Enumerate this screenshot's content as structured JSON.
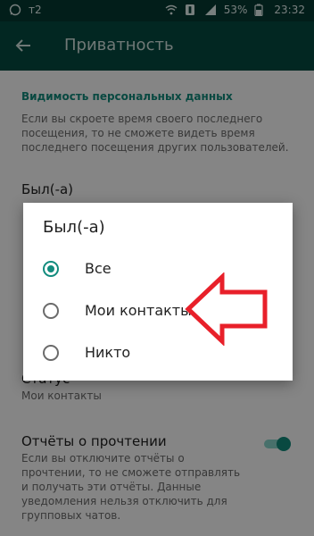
{
  "status_bar": {
    "carrier": "т2",
    "battery_percent": "53%",
    "time": "23:32",
    "icons": [
      "whatsapp-icon",
      "wifi-icon",
      "sim1-icon",
      "signal-icon",
      "battery-icon"
    ]
  },
  "appbar": {
    "title": "Приватность",
    "back_icon": "arrow-left-icon"
  },
  "settings": {
    "section_title": "Видимость персональных данных",
    "section_desc": "Если вы скроете время своего последнего посещения, то не сможете видеть время последнего посещения других пользователей.",
    "last_seen_title": "Был(-а)",
    "status_title": "Статус",
    "status_value": "Мои контакты",
    "read_receipts_title": "Отчёты о прочтении",
    "read_receipts_desc": "Если вы отключите отчёты о прочтении, то не сможете отправлять и получать эти отчёты. Данные уведомления нельзя отключить для групповых чатов.",
    "read_receipts_enabled": true
  },
  "dialog": {
    "title": "Был(-а)",
    "options": [
      {
        "label": "Все",
        "selected": true
      },
      {
        "label": "Мои контакты",
        "selected": false
      },
      {
        "label": "Никто",
        "selected": false
      }
    ]
  },
  "colors": {
    "status_bar": "#043b33",
    "app_bar": "#054b41",
    "accent": "#128c7e",
    "arrow": "#e8202a"
  }
}
